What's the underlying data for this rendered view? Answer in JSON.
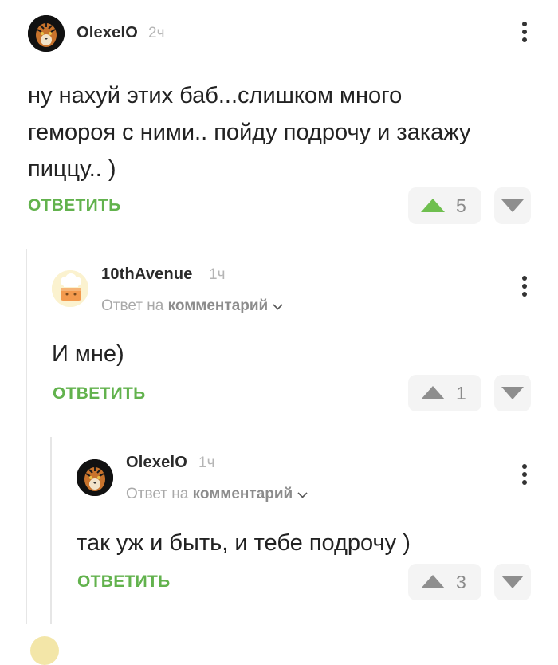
{
  "reply_label": "ОТВЕТИТЬ",
  "reply_to_prefix": "Ответ на",
  "reply_to_link": "комментарий",
  "colors": {
    "accent_green": "#62b24d",
    "upvote_active": "#6fbf4f",
    "vote_inactive": "#8e8e8e"
  },
  "comments": [
    {
      "username": "OlexelO",
      "time": "2ч",
      "text": "ну нахуй этих баб...слишком много\nгемороя с ними.. пойду подрочу и закажу\nпиццу.. )",
      "rating": "5",
      "upvoted": true,
      "avatar_icon": "tiger-avatar-icon"
    },
    {
      "username": "10thAvenue",
      "time": "1ч",
      "text": "И мне)",
      "rating": "1",
      "upvoted": false,
      "avatar_icon": "chef-cake-avatar-icon"
    },
    {
      "username": "OlexelO",
      "time": "1ч",
      "text": "так уж и быть, и тебе подрочу )",
      "rating": "3",
      "upvoted": false,
      "avatar_icon": "tiger-avatar-icon"
    }
  ]
}
